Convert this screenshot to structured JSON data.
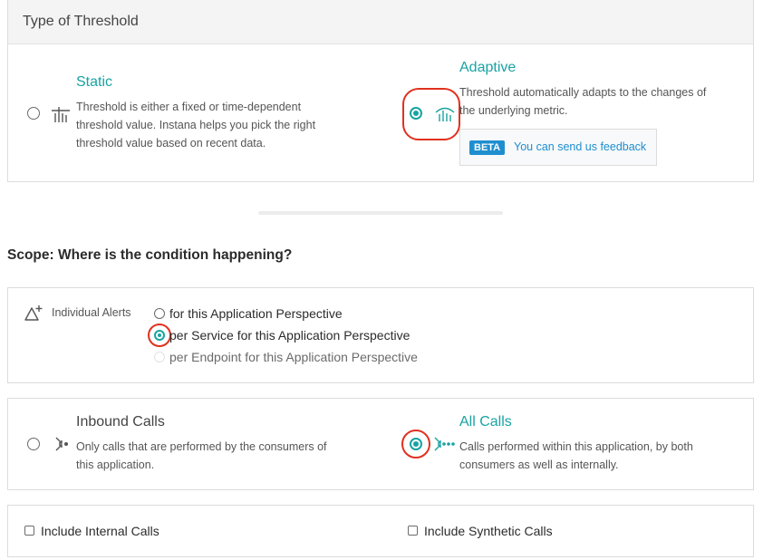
{
  "threshold": {
    "header_title": "Type of Threshold",
    "static": {
      "title": "Static",
      "description_lines": [
        "Threshold is either a fixed or time-dependent",
        "threshold value. Instana helps you pick the right",
        "threshold value based on recent data."
      ],
      "selected": false
    },
    "adaptive": {
      "title": "Adaptive",
      "description_lines": [
        "Threshold automatically adapts to the changes of",
        "the underlying metric."
      ],
      "selected": true,
      "beta_badge": "BETA",
      "feedback_link": "You can send us feedback"
    }
  },
  "scope": {
    "heading": "Scope: Where is the condition happening?",
    "individual_alerts_label": "Individual Alerts",
    "options": [
      {
        "label": "for this Application Perspective",
        "selected": false,
        "disabled": false
      },
      {
        "label": "per Service for this Application Perspective",
        "selected": true,
        "disabled": false
      },
      {
        "label": "per Endpoint for this Application Perspective",
        "selected": false,
        "disabled": true
      }
    ]
  },
  "calls": {
    "inbound": {
      "title": "Inbound Calls",
      "description_lines": [
        "Only calls that are performed by the consumers of",
        "this application."
      ],
      "selected": false
    },
    "all": {
      "title": "All Calls",
      "description_lines": [
        "Calls performed within this application, by both",
        "consumers as well as internally."
      ],
      "selected": true
    }
  },
  "include": {
    "internal_label": "Include Internal Calls",
    "synthetic_label": "Include Synthetic Calls"
  },
  "colors": {
    "accent": "#19a3a3",
    "highlight": "#e0311f",
    "beta_bg": "#1f8ecf"
  }
}
